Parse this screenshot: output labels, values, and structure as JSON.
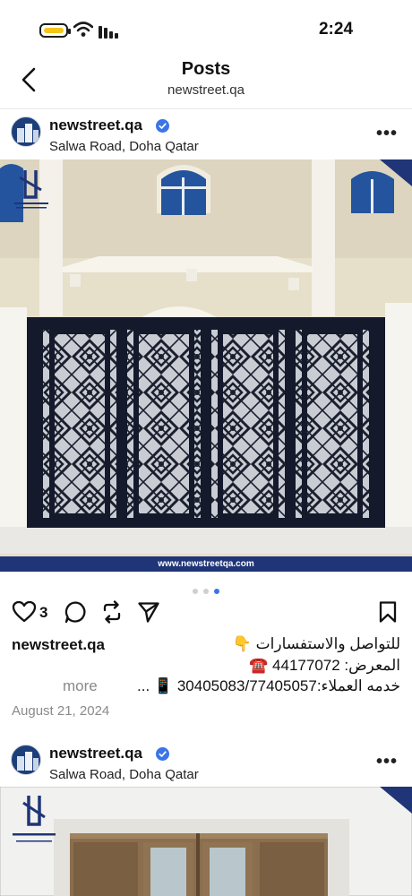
{
  "status": {
    "time": "2:24"
  },
  "nav": {
    "title": "Posts",
    "subtitle": "newstreet.qa"
  },
  "posts": [
    {
      "account": "newstreet.qa",
      "location": "Salwa Road, Doha Qatar",
      "image_watermark": "www.newstreetqa.com",
      "carousel": {
        "count": 3,
        "active": 3
      },
      "likes": "3",
      "caption_user": "newstreet.qa",
      "caption_lines": [
        "للتواصل والاستفسارات 👇",
        "المعرض: 44177072 ☎️",
        "خدمه العملاء:30405083/77405057 📱 ..."
      ],
      "more": "more",
      "date": "August 21, 2024"
    },
    {
      "account": "newstreet.qa",
      "location": "Salwa Road, Doha Qatar"
    }
  ],
  "colors": {
    "brand_navy": "#1f3577",
    "verified_blue": "#3a74e8",
    "battery_yellow": "#f5c518"
  }
}
